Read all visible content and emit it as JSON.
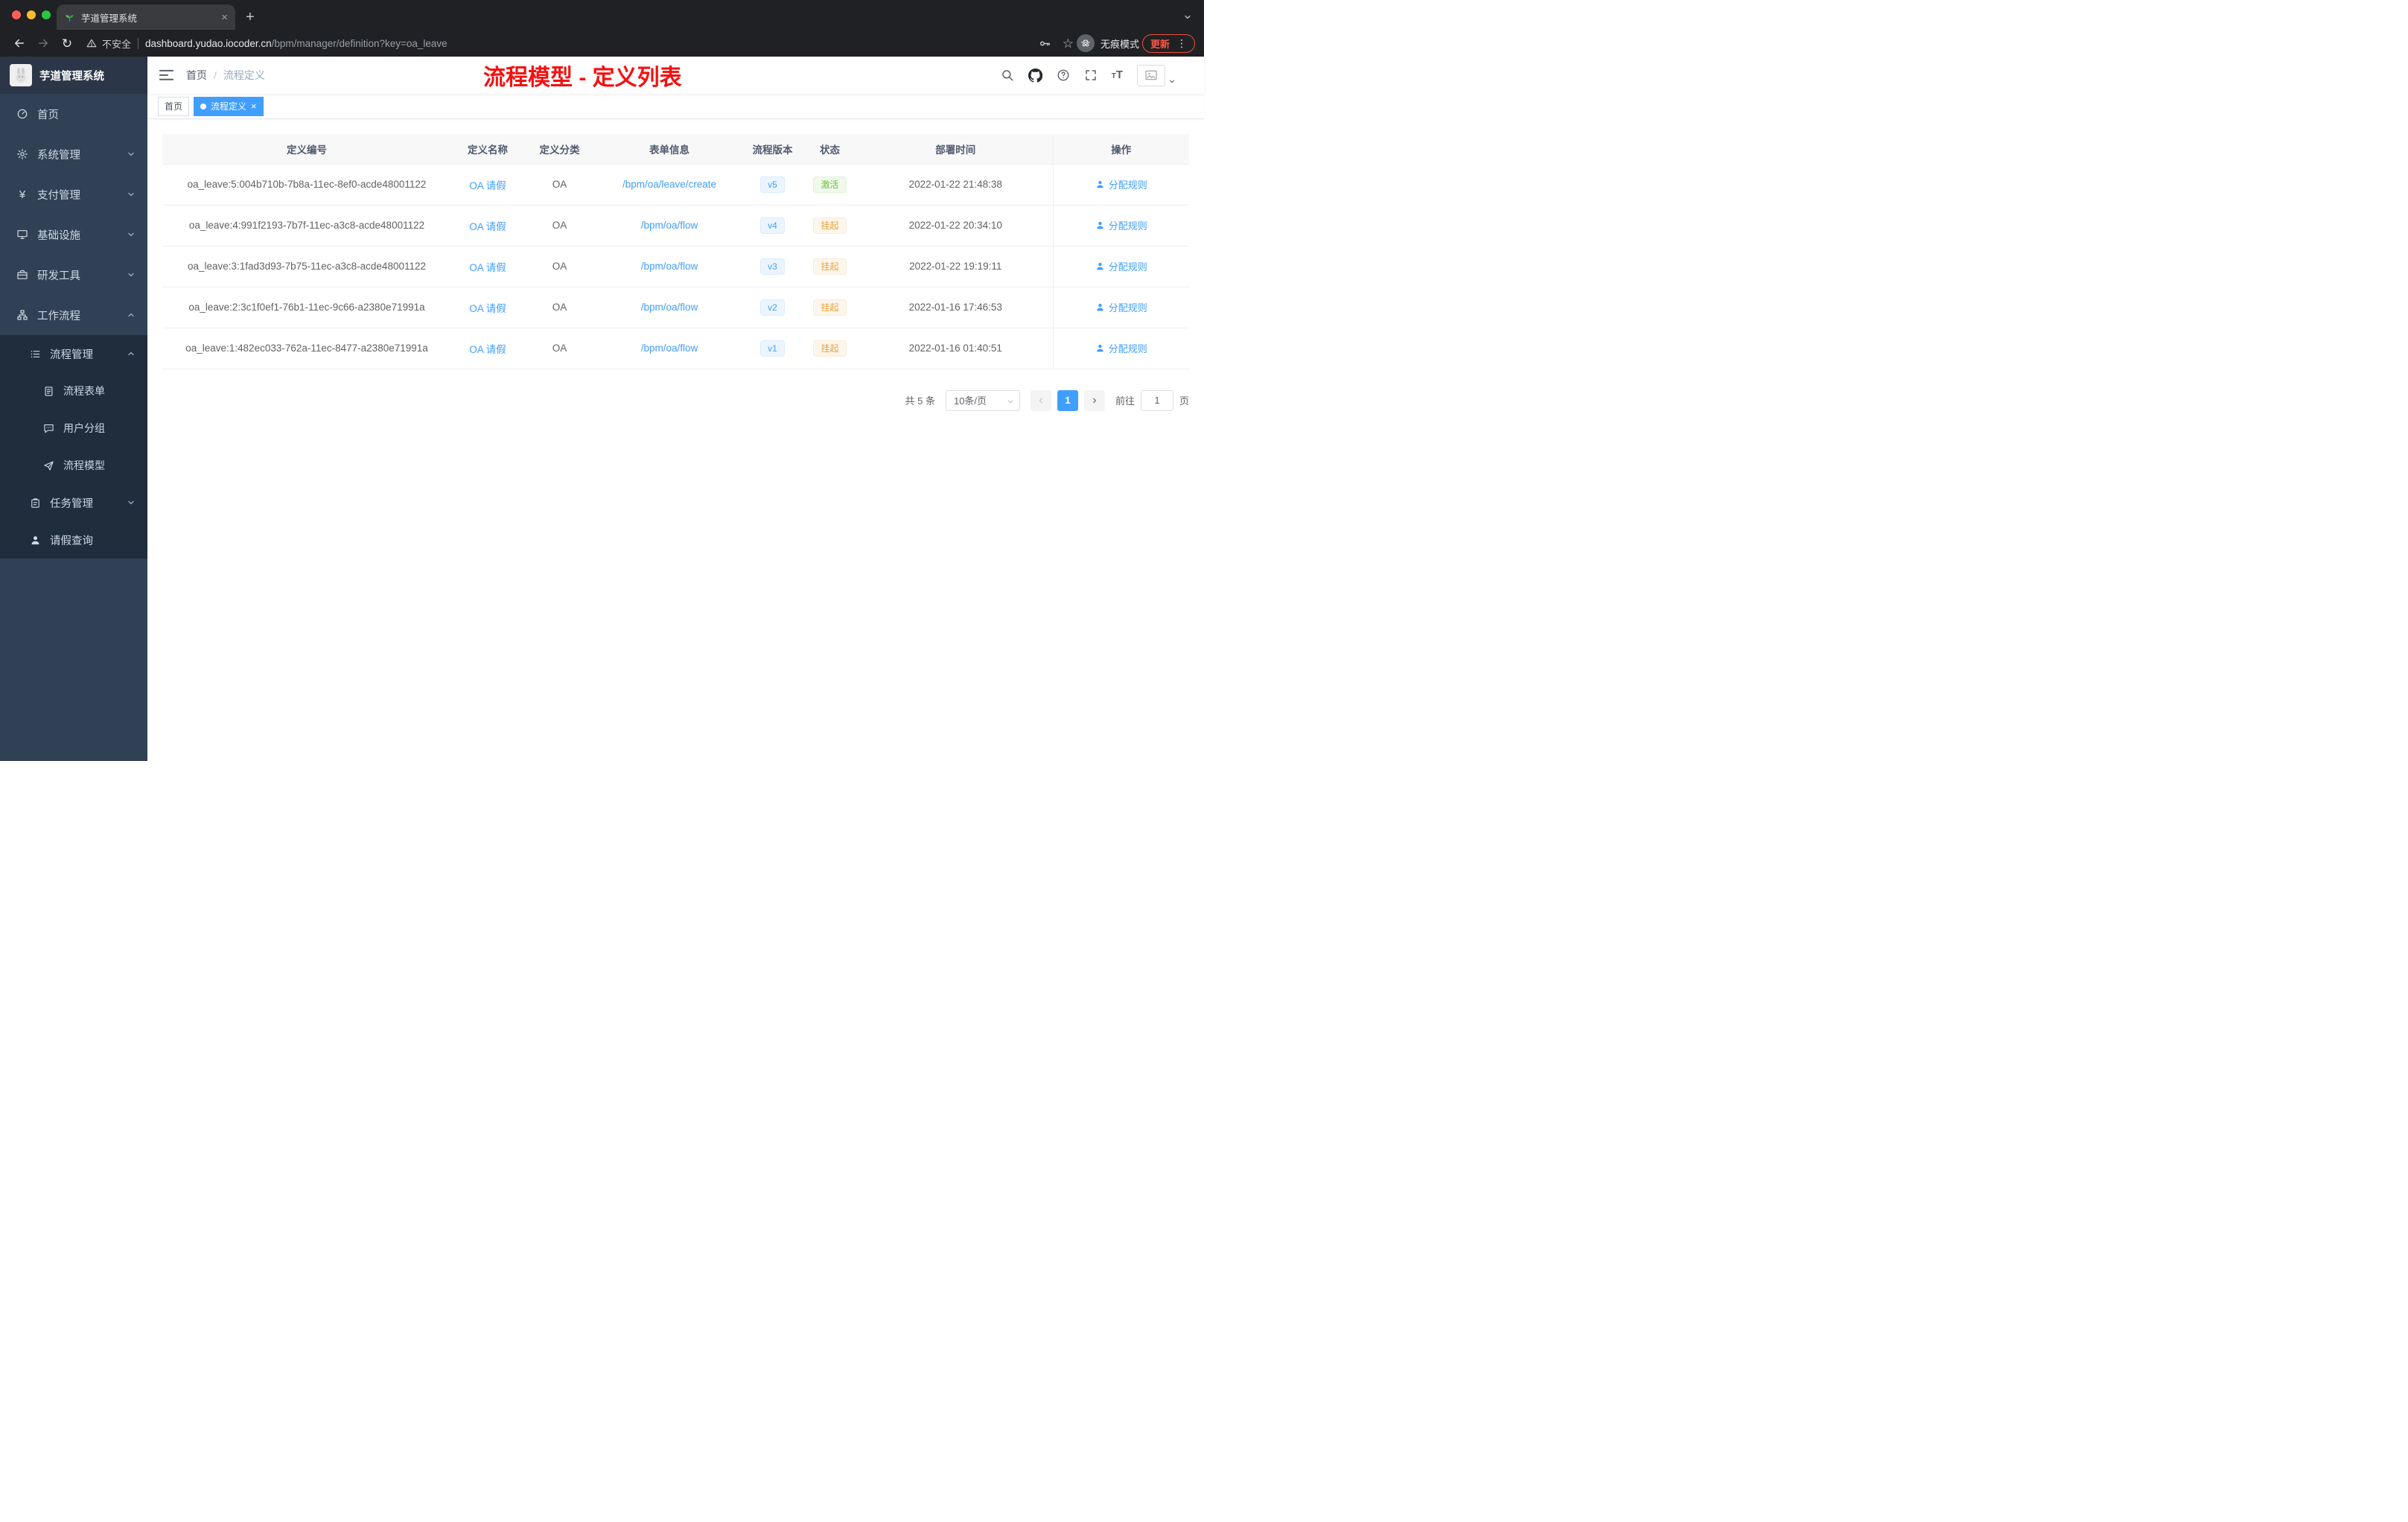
{
  "browser": {
    "tab_title": "芋道管理系统",
    "security_label": "不安全",
    "url_host": "dashboard.yudao.iocoder.cn",
    "url_path": "/bpm/manager/definition?key=oa_leave",
    "incognito_label": "无痕模式",
    "update_label": "更新"
  },
  "sidebar": {
    "logo_title": "芋道管理系统",
    "items": [
      {
        "label": "首页"
      },
      {
        "label": "系统管理"
      },
      {
        "label": "支付管理"
      },
      {
        "label": "基础设施"
      },
      {
        "label": "研发工具"
      },
      {
        "label": "工作流程"
      },
      {
        "label": "流程管理"
      },
      {
        "label": "流程表单"
      },
      {
        "label": "用户分组"
      },
      {
        "label": "流程模型"
      },
      {
        "label": "任务管理"
      },
      {
        "label": "请假查询"
      }
    ]
  },
  "header": {
    "breadcrumb_home": "首页",
    "breadcrumb_current": "流程定义",
    "annotation": "流程模型 - 定义列表"
  },
  "tags": [
    {
      "label": "首页"
    },
    {
      "label": "流程定义"
    }
  ],
  "table": {
    "columns": [
      "定义编号",
      "定义名称",
      "定义分类",
      "表单信息",
      "流程版本",
      "状态",
      "部署时间",
      "操作"
    ],
    "rows": [
      {
        "id": "oa_leave:5:004b710b-7b8a-11ec-8ef0-acde48001122",
        "name": "OA 请假",
        "category": "OA",
        "form": "/bpm/oa/leave/create",
        "version": "v5",
        "status": "激活",
        "status_type": "active",
        "deployed_at": "2022-01-22 21:48:38",
        "action": "分配规则"
      },
      {
        "id": "oa_leave:4:991f2193-7b7f-11ec-a3c8-acde48001122",
        "name": "OA 请假",
        "category": "OA",
        "form": "/bpm/oa/flow",
        "version": "v4",
        "status": "挂起",
        "status_type": "suspended",
        "deployed_at": "2022-01-22 20:34:10",
        "action": "分配规则"
      },
      {
        "id": "oa_leave:3:1fad3d93-7b75-11ec-a3c8-acde48001122",
        "name": "OA 请假",
        "category": "OA",
        "form": "/bpm/oa/flow",
        "version": "v3",
        "status": "挂起",
        "status_type": "suspended",
        "deployed_at": "2022-01-22 19:19:11",
        "action": "分配规则"
      },
      {
        "id": "oa_leave:2:3c1f0ef1-76b1-11ec-9c66-a2380e71991a",
        "name": "OA 请假",
        "category": "OA",
        "form": "/bpm/oa/flow",
        "version": "v2",
        "status": "挂起",
        "status_type": "suspended",
        "deployed_at": "2022-01-16 17:46:53",
        "action": "分配规则"
      },
      {
        "id": "oa_leave:1:482ec033-762a-11ec-8477-a2380e71991a",
        "name": "OA 请假",
        "category": "OA",
        "form": "/bpm/oa/flow",
        "version": "v1",
        "status": "挂起",
        "status_type": "suspended",
        "deployed_at": "2022-01-16 01:40:51",
        "action": "分配规则"
      }
    ]
  },
  "pagination": {
    "total_label": "共 5 条",
    "page_size_label": "10条/页",
    "current_page": "1",
    "goto_label": "前往",
    "goto_value": "1",
    "page_unit": "页"
  },
  "colors": {
    "accent_blue": "#409eff",
    "status_active_green": "#67c23a",
    "status_suspended_orange": "#e6a23c",
    "annotation_red": "#f31111",
    "sidebar_bg": "#304156"
  }
}
